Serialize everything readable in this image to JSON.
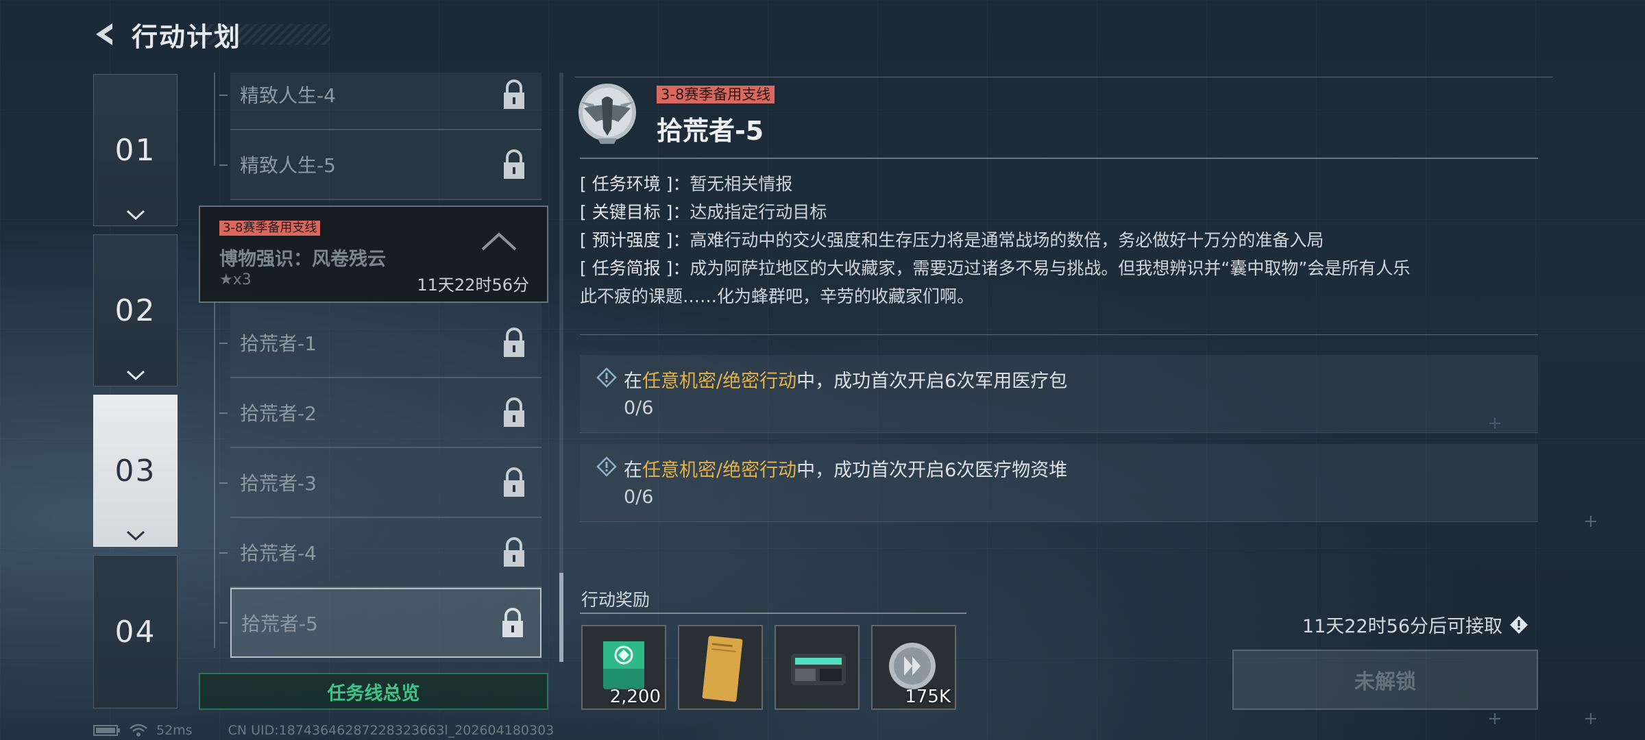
{
  "header": {
    "title": "行动计划"
  },
  "chapters": [
    {
      "label": "01"
    },
    {
      "label": "02"
    },
    {
      "label": "03",
      "active": true
    },
    {
      "label": "04"
    }
  ],
  "missions_above": [
    {
      "label": "精致人生-4"
    },
    {
      "label": "精致人生-5"
    }
  ],
  "group": {
    "tag": "3-8赛季备用支线",
    "title": "博物强识：风卷残云",
    "stars": "★x3",
    "timer": "11天22时56分"
  },
  "missions": [
    {
      "label": "拾荒者-1"
    },
    {
      "label": "拾荒者-2"
    },
    {
      "label": "拾荒者-3"
    },
    {
      "label": "拾荒者-4"
    },
    {
      "label": "拾荒者-5",
      "selected": true
    }
  ],
  "overview_button": "任务线总览",
  "detail": {
    "tag": "3-8赛季备用支线",
    "title": "拾荒者-5",
    "info": [
      {
        "key": "[ 任务环境 ]：",
        "value": "暂无相关情报"
      },
      {
        "key": "[ 关键目标 ]：",
        "value": "达成指定行动目标"
      },
      {
        "key": "[ 预计强度 ]：",
        "value": "高难行动中的交火强度和生存压力将是通常战场的数倍，务必做好十万分的准备入局"
      },
      {
        "key": "[ 任务简报 ]：",
        "value": "成为阿萨拉地区的大收藏家，需要迈过诸多不易与挑战。但我想辨识并“囊中取物”会是所有人乐"
      },
      {
        "key": "",
        "value": "此不疲的课题……化为蜂群吧，辛劳的收藏家们啊。"
      }
    ],
    "objectives": [
      {
        "prefix": "在",
        "highlight": "任意机密/绝密行动",
        "suffix": "中，成功首次开启6次军用医疗包",
        "progress": "0/6"
      },
      {
        "prefix": "在",
        "highlight": "任意机密/绝密行动",
        "suffix": "中，成功首次开启6次医疗物资堆",
        "progress": "0/6"
      }
    ],
    "reward_label": "行动奖励",
    "rewards": [
      {
        "icon": "green-card-icon",
        "qty": "2,200"
      },
      {
        "icon": "document-icon",
        "qty": ""
      },
      {
        "icon": "device-case-icon",
        "qty": ""
      },
      {
        "icon": "silver-coin-icon",
        "qty": "175K"
      }
    ],
    "unlock_time": "11天22时56分后可接取",
    "locked_button": "未解锁"
  },
  "status": {
    "ping": "52ms",
    "uid": "CN UID:18743646287228323663l_202604180303"
  },
  "colors": {
    "accent_green": "#3ec38a",
    "highlight_gold": "#e3b347",
    "tag_red": "#d9685f"
  }
}
